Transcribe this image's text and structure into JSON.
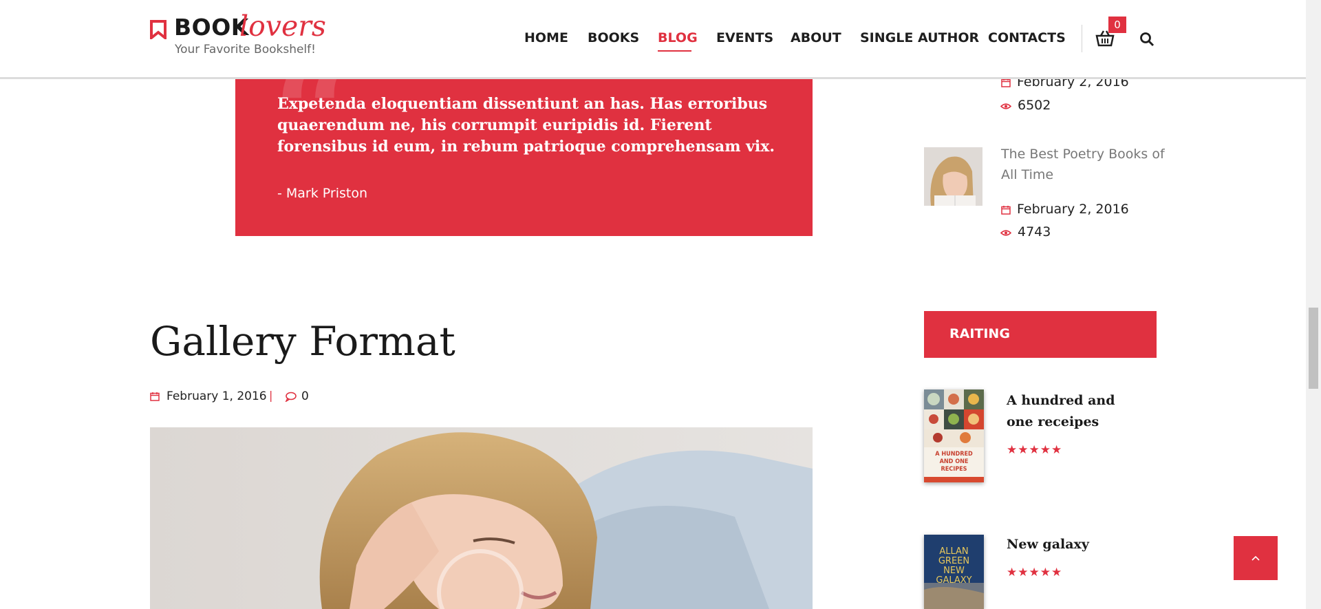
{
  "header": {
    "logo_book": "BOOK",
    "logo_lovers": "lovers",
    "tagline": "Your Favorite Bookshelf!",
    "nav": [
      "HOME",
      "BOOKS",
      "BLOG",
      "EVENTS",
      "ABOUT",
      "SINGLE AUTHOR",
      "CONTACTS"
    ],
    "active_nav": "BLOG",
    "cart_count": "0"
  },
  "quote": {
    "mark": "“",
    "text": "Expetenda eloquentiam dissentiunt an has. Has erroribus quaerendum ne, his corrumpit euripidis id. Fierent forensibus id eum, in rebum patrioque comprehensam vix.",
    "author": "- Mark Priston"
  },
  "post": {
    "title": "Gallery Format",
    "date": "February 1, 2016",
    "separator": "|",
    "comments": "0"
  },
  "sidebar": {
    "popular": [
      {
        "date": "February 2, 2016",
        "views": "6502"
      },
      {
        "title": "The Best Poetry Books of All Time",
        "date": "February 2, 2016",
        "views": "4743"
      }
    ],
    "raiting_heading": "RAITING",
    "books": [
      {
        "title": "A hundred and one receipes",
        "cover_text": "A HUNDRED AND ONE RECIPES",
        "rating": 5
      },
      {
        "title": "New galaxy",
        "cover_text": "ALLAN GREEN NEW GALAXY",
        "rating": 5
      }
    ],
    "stars_text": "★★★★★"
  },
  "colors": {
    "accent": "#e03140",
    "text_dark": "#1a1a1a",
    "muted": "#777777"
  }
}
